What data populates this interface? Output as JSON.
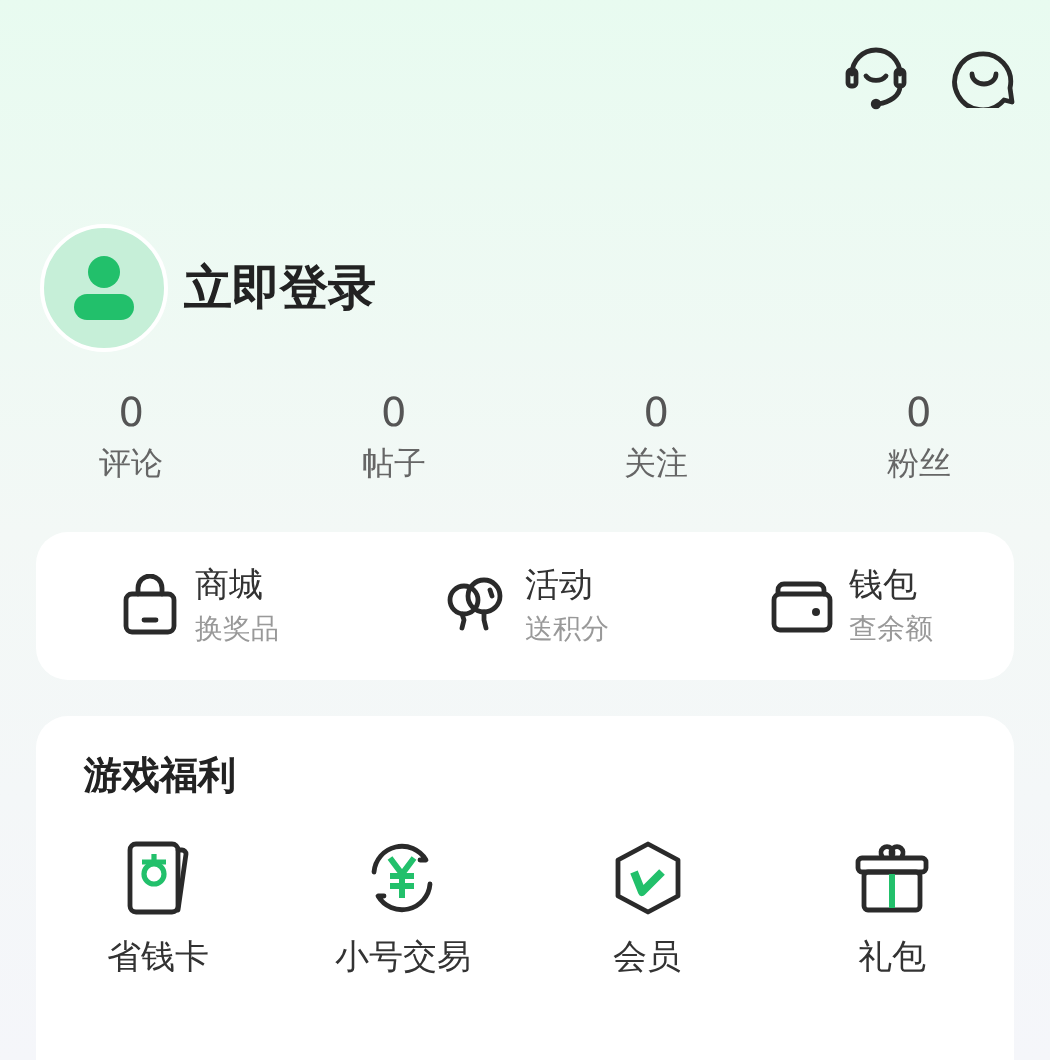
{
  "header": {
    "login_label": "立即登录"
  },
  "stats": [
    {
      "value": "0",
      "label": "评论"
    },
    {
      "value": "0",
      "label": "帖子"
    },
    {
      "value": "0",
      "label": "关注"
    },
    {
      "value": "0",
      "label": "粉丝"
    }
  ],
  "shortcuts": [
    {
      "kind": "bag",
      "title": "商城",
      "subtitle": "换奖品"
    },
    {
      "kind": "balloon",
      "title": "活动",
      "subtitle": "送积分"
    },
    {
      "kind": "wallet",
      "title": "钱包",
      "subtitle": "查余额"
    }
  ],
  "benefits": {
    "title": "游戏福利",
    "items": [
      {
        "kind": "card",
        "label": "省钱卡"
      },
      {
        "kind": "trade",
        "label": "小号交易"
      },
      {
        "kind": "vip",
        "label": "会员"
      },
      {
        "kind": "gift",
        "label": "礼包"
      }
    ]
  }
}
